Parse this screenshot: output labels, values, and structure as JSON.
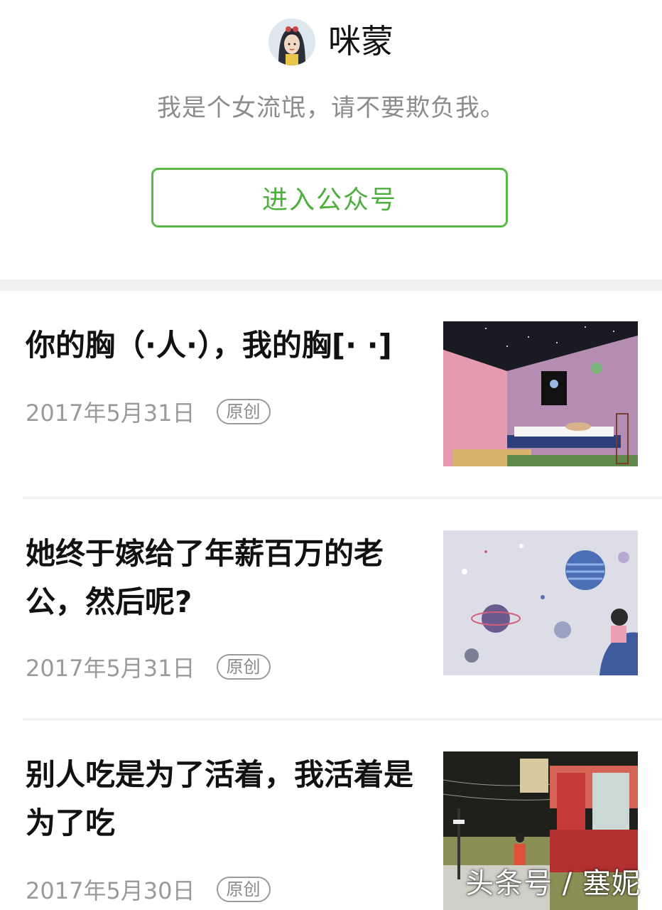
{
  "account": {
    "name": "咪蒙",
    "bio": "我是个女流氓，请不要欺负我。",
    "enter_button": "进入公众号"
  },
  "articles": [
    {
      "title": "你的胸（·人·），我的胸[·  ·]",
      "date": "2017年5月31日",
      "badge": "原创",
      "thumb": "room-space-illustration"
    },
    {
      "title": "她终于嫁给了年薪百万的老公，然后呢?",
      "date": "2017年5月31日",
      "badge": "原创",
      "thumb": "planets-illustration"
    },
    {
      "title": "别人吃是为了活着，我活着是为了吃",
      "date": "2017年5月30日",
      "badge": "原创",
      "thumb": "street-vending-illustration"
    }
  ],
  "watermark": "头条号 / 塞妮",
  "colors": {
    "accent": "#4fae3f",
    "muted": "#9a9a9a",
    "separator": "#f0f0f2"
  }
}
